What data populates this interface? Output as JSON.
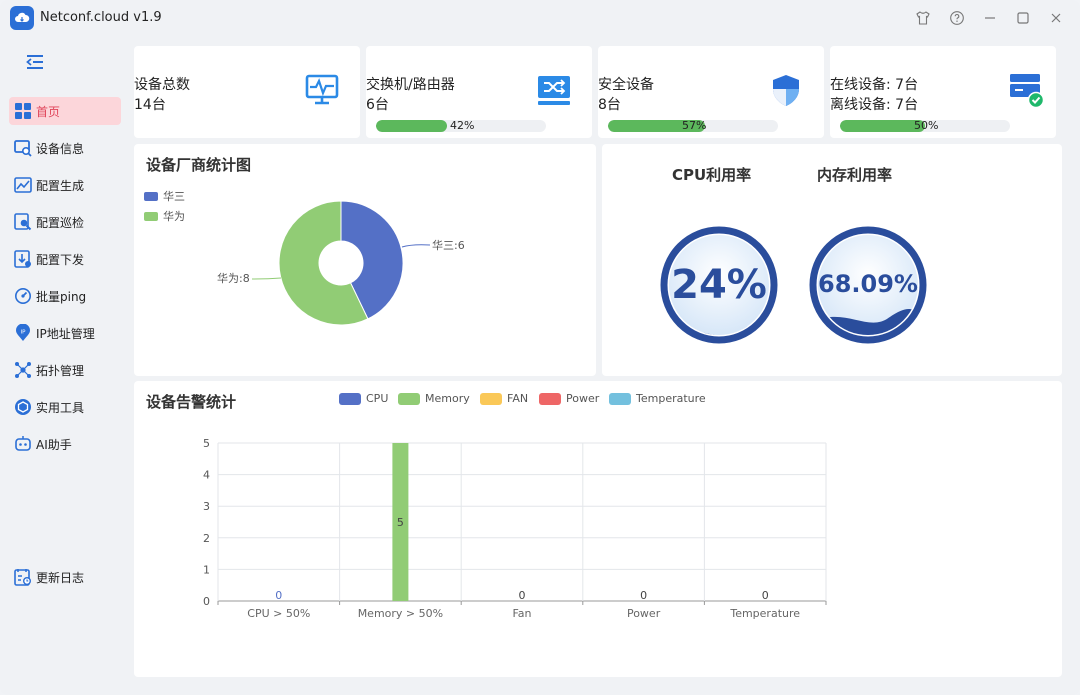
{
  "app": {
    "title": "Netconf.cloud v1.9"
  },
  "titlebar_icons": [
    "shirt-icon",
    "help-icon",
    "minimize-icon",
    "maximize-icon",
    "close-icon"
  ],
  "sidebar": {
    "items": [
      {
        "label": "首页",
        "icon": "dashboard-icon",
        "active": true
      },
      {
        "label": "设备信息",
        "icon": "device-info-icon"
      },
      {
        "label": "配置生成",
        "icon": "config-generate-icon"
      },
      {
        "label": "配置巡检",
        "icon": "config-inspect-icon"
      },
      {
        "label": "配置下发",
        "icon": "config-deploy-icon"
      },
      {
        "label": "批量ping",
        "icon": "ping-icon"
      },
      {
        "label": "IP地址管理",
        "icon": "ip-pin-icon"
      },
      {
        "label": "拓扑管理",
        "icon": "topology-icon"
      },
      {
        "label": "实用工具",
        "icon": "tools-icon"
      },
      {
        "label": "AI助手",
        "icon": "ai-assistant-icon"
      }
    ],
    "changelog": {
      "label": "更新日志",
      "icon": "changelog-icon"
    }
  },
  "stats": [
    {
      "label": "设备总数",
      "value": "14台",
      "icon": "monitor-icon"
    },
    {
      "label": "交换机/路由器",
      "value": "6台",
      "progress": 0.42,
      "progress_text": "42%",
      "icon": "switch-icon"
    },
    {
      "label": "安全设备",
      "value": "8台",
      "progress": 0.57,
      "progress_text": "57%",
      "icon": "shield-icon"
    },
    {
      "label": "在线设备: 7台",
      "value": "离线设备: 7台",
      "progress": 0.5,
      "progress_text": "50%",
      "icon": "server-online-icon"
    }
  ],
  "vendor_chart": {
    "title": "设备厂商统计图",
    "legend": [
      {
        "name": "华三",
        "color": "#5470c6"
      },
      {
        "name": "华为",
        "color": "#91cc75"
      }
    ],
    "labels": [
      "华三:6",
      "华为:8"
    ]
  },
  "gauges": {
    "cpu": {
      "title": "CPU利用率",
      "value_text": "24%",
      "value": 24
    },
    "memory": {
      "title": "内存利用率",
      "value_text": "68.09%",
      "value": 68.09
    }
  },
  "alarm_chart": {
    "title": "设备告警统计",
    "legend": [
      {
        "name": "CPU",
        "color": "#5470c6"
      },
      {
        "name": "Memory",
        "color": "#91cc75"
      },
      {
        "name": "FAN",
        "color": "#fac858"
      },
      {
        "name": "Power",
        "color": "#ee6666"
      },
      {
        "name": "Temperature",
        "color": "#73c0de"
      }
    ]
  },
  "chart_data": [
    {
      "type": "pie",
      "title": "设备厂商统计图",
      "categories": [
        "华三",
        "华为"
      ],
      "values": [
        6,
        8
      ],
      "colors": [
        "#5470c6",
        "#91cc75"
      ],
      "legend_position": "top-left"
    },
    {
      "type": "bar",
      "title": "设备告警统计",
      "categories": [
        "CPU > 50%",
        "Memory > 50%",
        "Fan",
        "Power",
        "Temperature"
      ],
      "series": [
        {
          "name": "CPU",
          "values": [
            0,
            null,
            null,
            null,
            null
          ]
        },
        {
          "name": "Memory",
          "values": [
            null,
            5,
            null,
            null,
            null
          ]
        },
        {
          "name": "FAN",
          "values": [
            null,
            null,
            0,
            null,
            null
          ]
        },
        {
          "name": "Power",
          "values": [
            null,
            null,
            null,
            0,
            null
          ]
        },
        {
          "name": "Temperature",
          "values": [
            null,
            null,
            null,
            null,
            0
          ]
        }
      ],
      "ylim": [
        0,
        5
      ],
      "yticks": [
        "0",
        "1",
        "2",
        "3",
        "4",
        "5"
      ],
      "grid": true,
      "legend_position": "top"
    }
  ]
}
